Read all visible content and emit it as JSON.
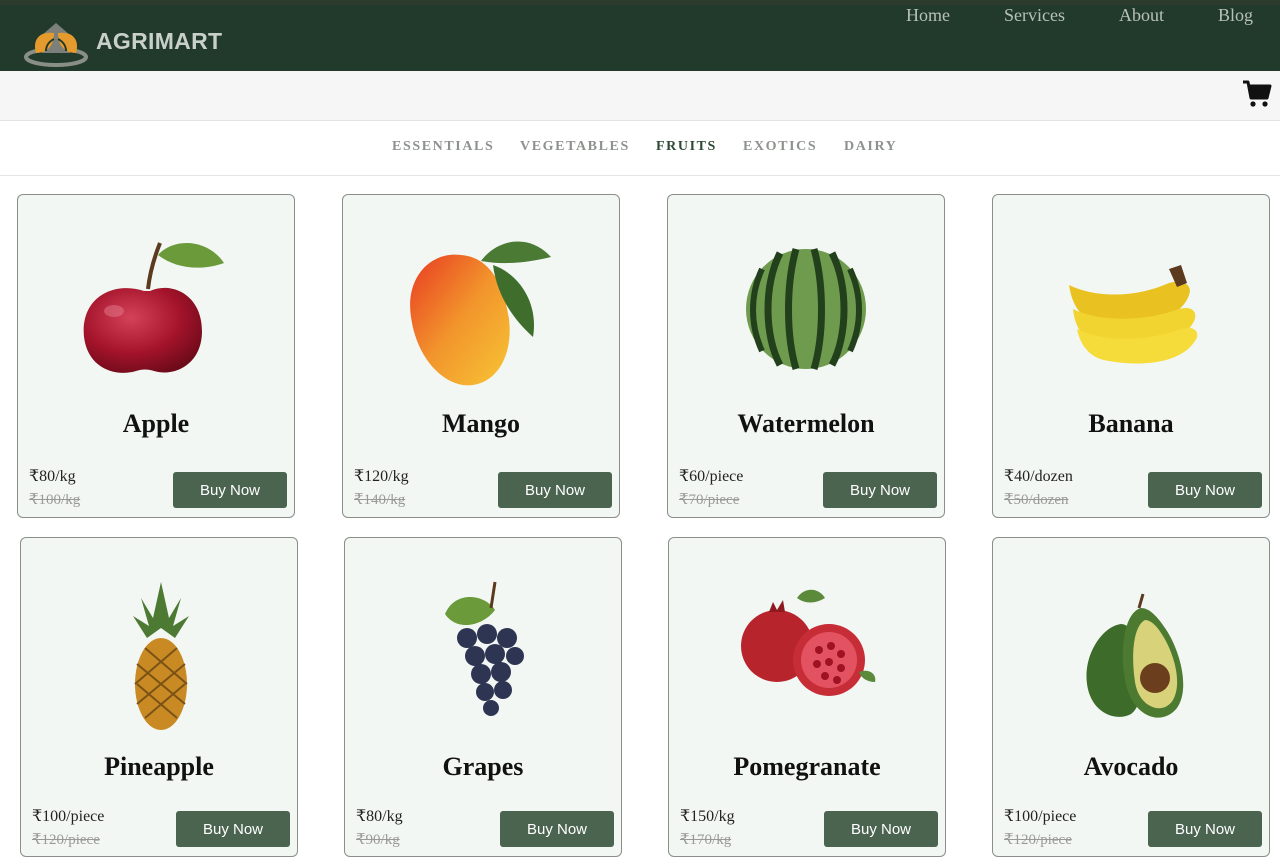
{
  "brand": {
    "name": "AGRIMART"
  },
  "nav": [
    "Home",
    "Services",
    "About",
    "Blog"
  ],
  "categories": [
    "ESSENTIALS",
    "VEGETABLES",
    "FRUITS",
    "EXOTICS",
    "DAIRY"
  ],
  "active_category": "FRUITS",
  "colors": {
    "header": "#213a2b",
    "button": "#4a6450",
    "card_bg": "#f3f7f4",
    "active_tab": "#2e4a36"
  },
  "products": [
    {
      "name": "Apple",
      "price": "₹80/kg",
      "old_price": "₹100/kg",
      "button": "Buy Now",
      "icon": "apple-icon"
    },
    {
      "name": "Mango",
      "price": "₹120/kg",
      "old_price": "₹140/kg",
      "button": "Buy Now",
      "icon": "mango-icon"
    },
    {
      "name": "Watermelon",
      "price": "₹60/piece",
      "old_price": "₹70/piece",
      "button": "Buy Now",
      "icon": "watermelon-icon"
    },
    {
      "name": "Banana",
      "price": "₹40/dozen",
      "old_price": "₹50/dozen",
      "button": "Buy Now",
      "icon": "banana-icon"
    },
    {
      "name": "Pineapple",
      "price": "₹100/piece",
      "old_price": "₹120/piece",
      "button": "Buy Now",
      "icon": "pineapple-icon"
    },
    {
      "name": "Grapes",
      "price": "₹80/kg",
      "old_price": "₹90/kg",
      "button": "Buy Now",
      "icon": "grapes-icon"
    },
    {
      "name": "Pomegranate",
      "price": "₹150/kg",
      "old_price": "₹170/kg",
      "button": "Buy Now",
      "icon": "pomegranate-icon"
    },
    {
      "name": "Avocado",
      "price": "₹100/piece",
      "old_price": "₹120/piece",
      "button": "Buy Now",
      "icon": "avocado-icon"
    }
  ]
}
